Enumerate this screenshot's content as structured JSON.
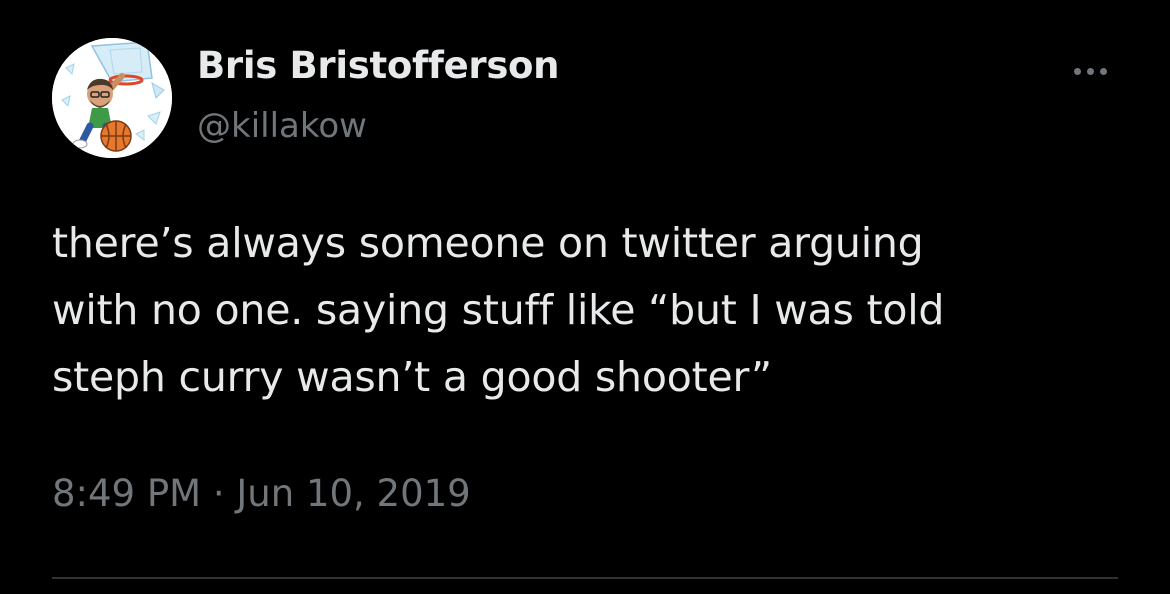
{
  "author": {
    "display_name": "Bris Bristofferson",
    "handle": "@killakow",
    "avatar_icon": "memoji-basketball-dunk-avatar"
  },
  "tweet": {
    "text_lines": [
      "there’s always someone on twitter arguing",
      "with no one. saying stuff like “but I was told",
      "steph curry wasn’t a good shooter”"
    ],
    "timestamp": "8:49 PM · Jun 10, 2019"
  },
  "actions": {
    "more_icon": "more-horizontal-icon"
  },
  "colors": {
    "background": "#000000",
    "primary_text": "#e7e9ea",
    "secondary_text": "#71767b",
    "divider": "#2f3336"
  }
}
